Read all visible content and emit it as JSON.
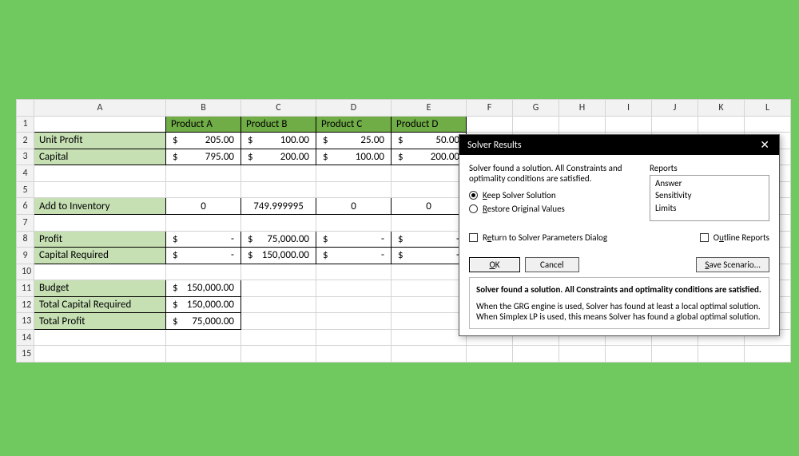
{
  "columns": [
    "",
    "A",
    "B",
    "C",
    "D",
    "E",
    "F",
    "G",
    "H",
    "I",
    "J",
    "K",
    "L"
  ],
  "rowHeaders": [
    "1",
    "2",
    "3",
    "4",
    "5",
    "6",
    "7",
    "8",
    "9",
    "10",
    "11",
    "12",
    "13",
    "14",
    "15"
  ],
  "selectedColumn": "G",
  "headerRow": {
    "b": "Product A",
    "c": "Product B",
    "d": "Product C",
    "e": "Product D"
  },
  "rows": {
    "r2": {
      "label": "Unit Profit",
      "b": "205.00",
      "c": "100.00",
      "d": "25.00",
      "e": "50.00"
    },
    "r3": {
      "label": "Capital",
      "b": "795.00",
      "c": "200.00",
      "d": "100.00",
      "e": "200.00"
    },
    "r6": {
      "label": "Add to Inventory",
      "b": "0",
      "c": "749.999995",
      "d": "0",
      "e": "0"
    },
    "r8": {
      "label": "Profit",
      "b": "-",
      "c": "75,000.00",
      "d": "-",
      "e": "-"
    },
    "r9": {
      "label": "Capital Required",
      "b": "-",
      "c": "150,000.00",
      "d": "-",
      "e": "-"
    },
    "r11": {
      "label": "Budget",
      "b": "150,000.00"
    },
    "r12": {
      "label": "Total Capital Required",
      "b": "150,000.00"
    },
    "r13": {
      "label": "Total Profit",
      "b": "75,000.00"
    }
  },
  "dollar": "$",
  "dash": "-",
  "dialog": {
    "title": "Solver Results",
    "message": "Solver found a solution.  All Constraints and optimality conditions are satisfied.",
    "options": {
      "keep": "Keep Solver Solution",
      "restore": "Restore Original Values"
    },
    "reportsLabel": "Reports",
    "reports": {
      "answer": "Answer",
      "sensitivity": "Sensitivity",
      "limits": "Limits"
    },
    "returnParams": "Return to Solver Parameters Dialog",
    "outlineReports": "Outline Reports",
    "ok": "OK",
    "cancel": "Cancel",
    "saveScenario": "Save Scenario...",
    "statusBold": "Solver found a solution.  All Constraints and optimality conditions are satisfied.",
    "statusBody": "When the GRG engine is used, Solver has found at least a local optimal solution. When Simplex LP is used, this means Solver has found a global optimal solution."
  }
}
